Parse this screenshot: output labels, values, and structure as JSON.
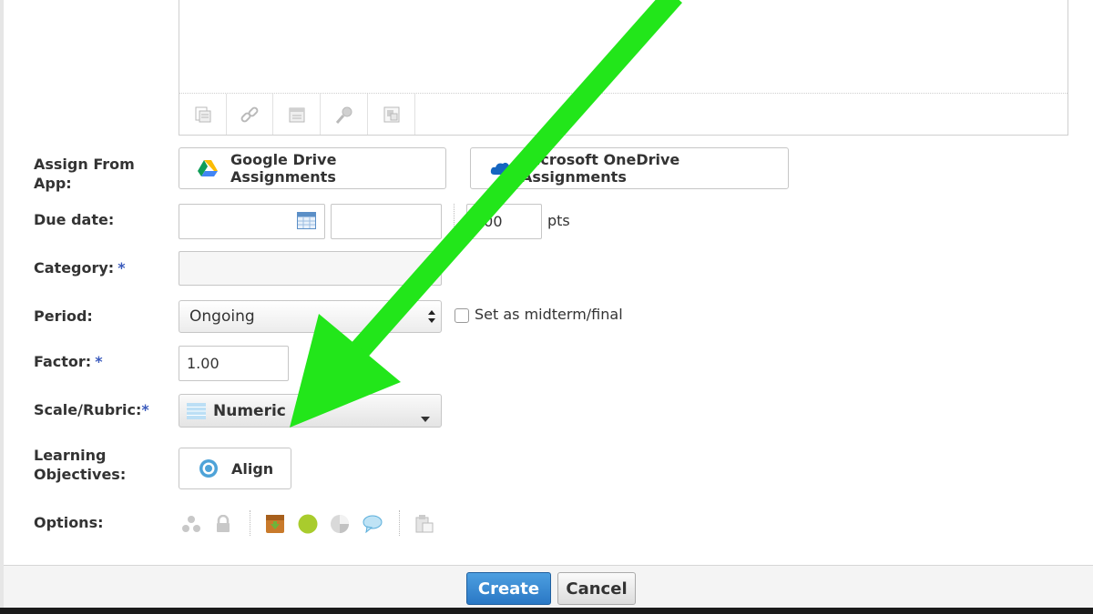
{
  "form": {
    "assign_from_app_label": "Assign From App:",
    "due_date_label": "Due date:",
    "category_label": "Category:",
    "period_label": "Period:",
    "factor_label": "Factor:",
    "scale_label": "Scale/Rubric:",
    "learning_objectives_label": "Learning Objectives:",
    "options_label": "Options:",
    "required_marker": "*"
  },
  "apps": {
    "google_drive": "Google Drive Assignments",
    "onedrive": "Microsoft OneDrive Assignments"
  },
  "fields": {
    "due_date_value": "",
    "due_time_value": "",
    "points_value": "100",
    "points_unit": "pts",
    "category_value": "",
    "period_value": "Ongoing",
    "midterm_label": "Set as midterm/final",
    "factor_value": "1.00",
    "scale_value": "Numeric",
    "align_label": "Align"
  },
  "editor_toolbar": [
    "insert-content-icon",
    "link-icon",
    "embed-icon",
    "record-icon",
    "insert-file-icon"
  ],
  "options_icons": [
    "individual-assign-icon",
    "lock-icon",
    "dropbox-icon",
    "published-icon",
    "grade-stats-icon",
    "comments-icon",
    "copy-icon"
  ],
  "colors": {
    "primary_button": "#2a78c5",
    "annotation_arrow": "#22e61a",
    "published_dot": "#a9cc2d",
    "required": "#3b5bbd"
  },
  "footer": {
    "create_label": "Create",
    "cancel_label": "Cancel"
  }
}
